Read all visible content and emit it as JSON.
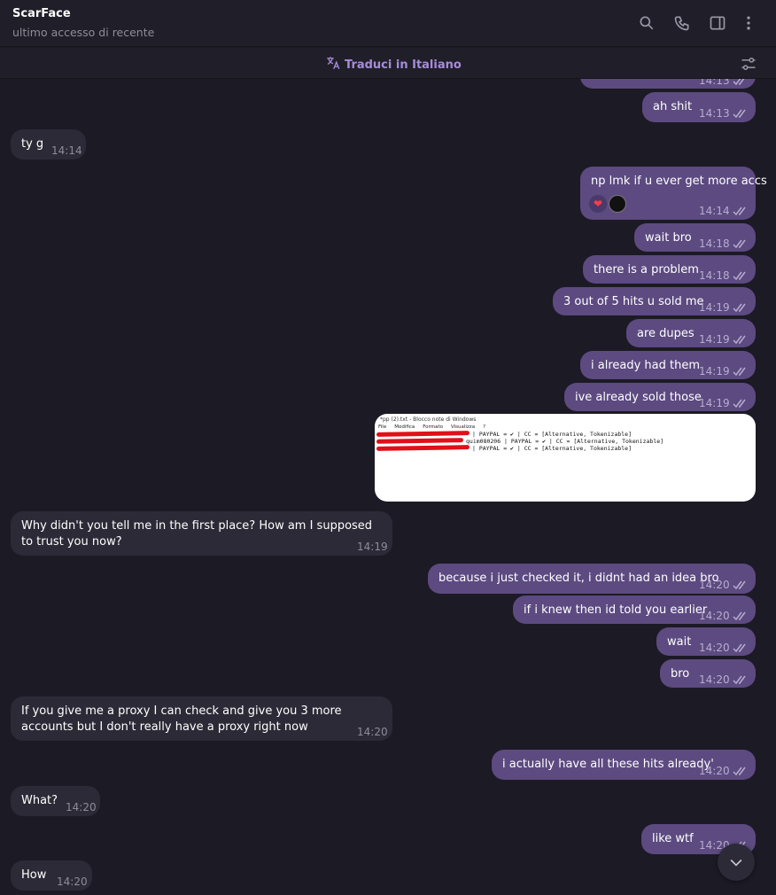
{
  "header": {
    "contact_name": "ScarFace",
    "status": "ultimo accesso di recente",
    "icons": [
      "search-icon",
      "phone-icon",
      "sidebar-toggle-icon",
      "more-vertical-icon"
    ]
  },
  "translate": {
    "label": "Traduci in Italiano",
    "icon": "translate-icon"
  },
  "messages": [
    {
      "dir": "out",
      "text": "ah shit",
      "time": "14:13"
    },
    {
      "dir": "in",
      "text": "ty g",
      "time": "14:14"
    },
    {
      "dir": "out",
      "text": "np lmk if u ever get more accs",
      "time": "14:14",
      "reactions": [
        "heart",
        "avatar"
      ]
    },
    {
      "dir": "out",
      "text": "wait bro",
      "time": "14:18"
    },
    {
      "dir": "out",
      "text": "there is a problem",
      "time": "14:18"
    },
    {
      "dir": "out",
      "text": "3 out of 5 hits u sold me",
      "time": "14:19"
    },
    {
      "dir": "out",
      "text": "are dupes",
      "time": "14:19"
    },
    {
      "dir": "out",
      "text": "i already had them",
      "time": "14:19"
    },
    {
      "dir": "out",
      "text": "ive already sold those",
      "time": "14:19"
    },
    {
      "dir": "in",
      "text": "Why didn't you tell me in the first place? How am I supposed to trust you now?",
      "time": "14:19"
    },
    {
      "dir": "out",
      "text": "because i just checked it, i didnt had an idea bro",
      "time": "14:20"
    },
    {
      "dir": "out",
      "text": "if i knew then id told you earlier",
      "time": "14:20"
    },
    {
      "dir": "out",
      "text": "wait",
      "time": "14:20"
    },
    {
      "dir": "out",
      "text": "bro",
      "time": "14:20"
    },
    {
      "dir": "in",
      "text": "If you give me a proxy I can check and give you 3 more accounts but I don't really have a proxy right now",
      "time": "14:20"
    },
    {
      "dir": "out",
      "text": "i actually have all these hits already'",
      "time": "14:20"
    },
    {
      "dir": "in",
      "text": "What?",
      "time": "14:20"
    },
    {
      "dir": "out",
      "text": "like wtf",
      "time": "14:20"
    },
    {
      "dir": "in",
      "text": "How",
      "time": "14:20"
    }
  ],
  "partial_top_time": "14:13",
  "screenshot_attachment": {
    "window_title": "*pp (2).txt - Blocco note di Windows",
    "menu": [
      "File",
      "Modifica",
      "Formato",
      "Visualizza",
      "?"
    ],
    "lines": [
      "| PAYPAL = ✔ | CC = [Alternative, Tokenizable]",
      "quim080206 | PAYPAL = ✔ | CC = [Alternative, Tokenizable]",
      "| PAYPAL = ✔ | CC = [Alternative, Tokenizable]"
    ]
  },
  "colors": {
    "background": "#1c1a24",
    "outgoing": "#5c4a80",
    "incoming": "#2c2a36",
    "accent": "#a78bdc"
  }
}
